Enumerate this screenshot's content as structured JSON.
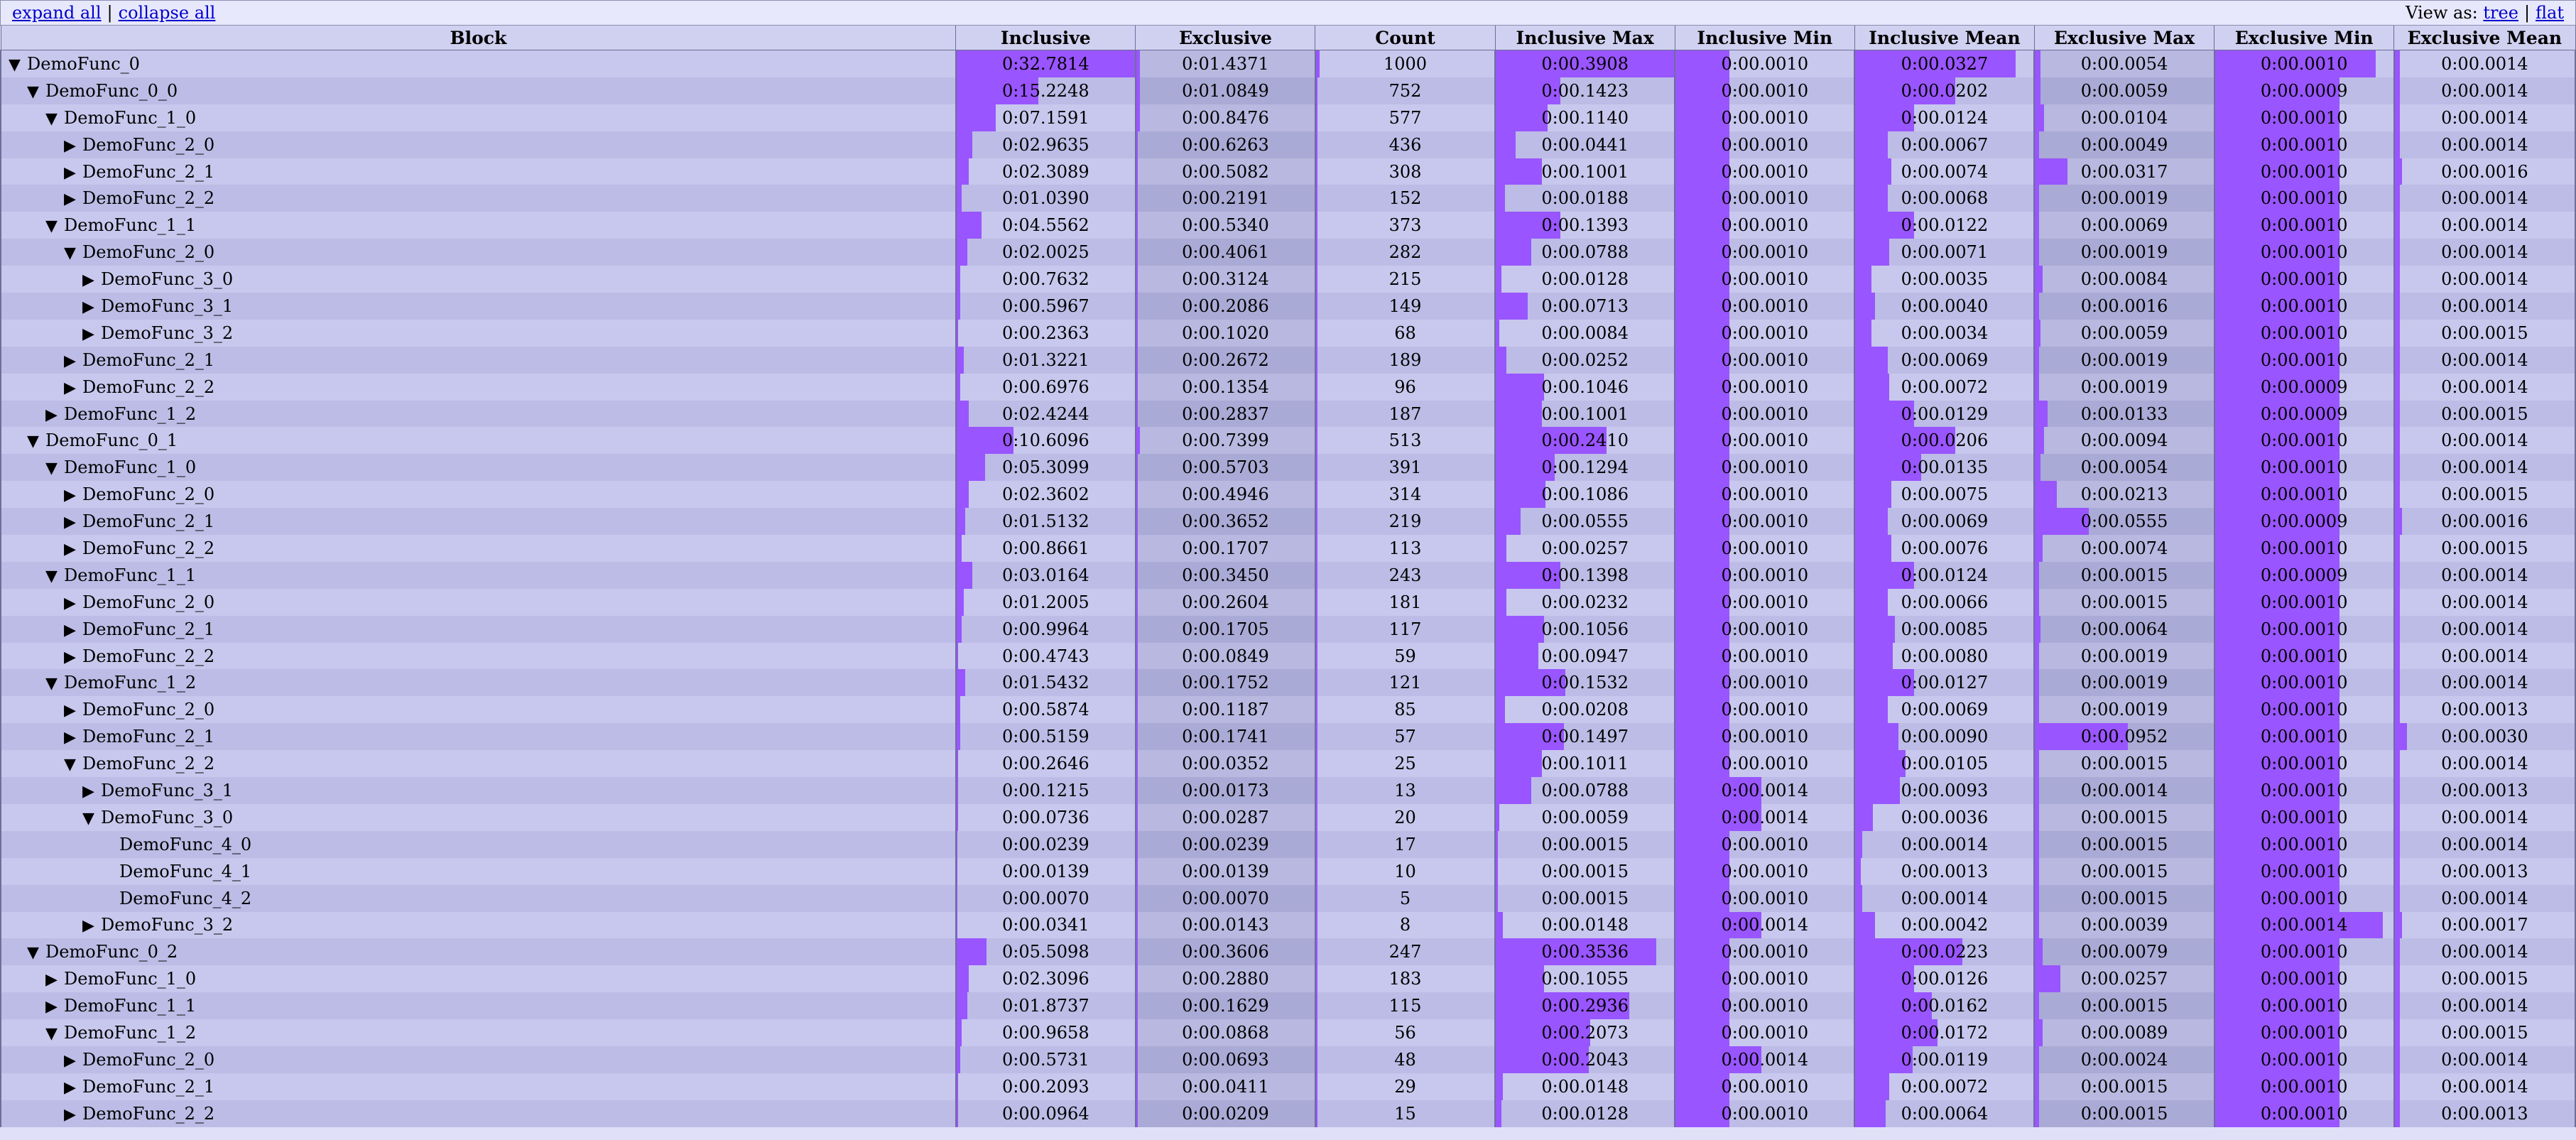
{
  "controls": {
    "expand_all": "expand all",
    "sep": "|",
    "collapse_all": "collapse all",
    "view_as": "View as:",
    "tree": "tree",
    "flat": "flat"
  },
  "columns": [
    "Block",
    "Inclusive",
    "Exclusive",
    "Count",
    "Inclusive Max",
    "Inclusive Min",
    "Inclusive Mean",
    "Exclusive Max",
    "Exclusive Min",
    "Exclusive Mean"
  ],
  "bar_color": "#9955ff",
  "rows": [
    {
      "name": "DemoFunc_0",
      "depth": 0,
      "toggle": "▼",
      "vals": [
        "0:32.7814",
        "0:01.4371",
        "1000",
        "0:00.3908",
        "0:00.0010",
        "0:00.0327",
        "0:00.0054",
        "0:00.0010",
        "0:00.0014"
      ],
      "bars": [
        1.0,
        0.02,
        0.02,
        1.0,
        0.3,
        0.9,
        0.03,
        0.9,
        0.03
      ]
    },
    {
      "name": "DemoFunc_0_0",
      "depth": 1,
      "toggle": "▼",
      "vals": [
        "0:15.2248",
        "0:01.0849",
        "752",
        "0:00.1423",
        "0:00.0010",
        "0:00.0202",
        "0:00.0059",
        "0:00.0009",
        "0:00.0014"
      ],
      "bars": [
        0.46,
        0.02,
        0.01,
        0.36,
        0.3,
        0.56,
        0.03,
        0.7,
        0.03
      ]
    },
    {
      "name": "DemoFunc_1_0",
      "depth": 2,
      "toggle": "▼",
      "vals": [
        "0:07.1591",
        "0:00.8476",
        "577",
        "0:00.1140",
        "0:00.0010",
        "0:00.0124",
        "0:00.0104",
        "0:00.0010",
        "0:00.0014"
      ],
      "bars": [
        0.22,
        0.02,
        0.01,
        0.29,
        0.3,
        0.33,
        0.05,
        0.7,
        0.03
      ]
    },
    {
      "name": "DemoFunc_2_0",
      "depth": 3,
      "toggle": "▶",
      "vals": [
        "0:02.9635",
        "0:00.6263",
        "436",
        "0:00.0441",
        "0:00.0010",
        "0:00.0067",
        "0:00.0049",
        "0:00.0010",
        "0:00.0014"
      ],
      "bars": [
        0.09,
        0.01,
        0.01,
        0.11,
        0.3,
        0.18,
        0.02,
        0.7,
        0.03
      ]
    },
    {
      "name": "DemoFunc_2_1",
      "depth": 3,
      "toggle": "▶",
      "vals": [
        "0:02.3089",
        "0:00.5082",
        "308",
        "0:00.1001",
        "0:00.0010",
        "0:00.0074",
        "0:00.0317",
        "0:00.0010",
        "0:00.0016"
      ],
      "bars": [
        0.07,
        0.01,
        0.01,
        0.26,
        0.3,
        0.2,
        0.18,
        0.7,
        0.04
      ]
    },
    {
      "name": "DemoFunc_2_2",
      "depth": 3,
      "toggle": "▶",
      "vals": [
        "0:01.0390",
        "0:00.2191",
        "152",
        "0:00.0188",
        "0:00.0010",
        "0:00.0068",
        "0:00.0019",
        "0:00.0010",
        "0:00.0014"
      ],
      "bars": [
        0.03,
        0.01,
        0.01,
        0.05,
        0.3,
        0.18,
        0.02,
        0.7,
        0.03
      ]
    },
    {
      "name": "DemoFunc_1_1",
      "depth": 2,
      "toggle": "▼",
      "vals": [
        "0:04.5562",
        "0:00.5340",
        "373",
        "0:00.1393",
        "0:00.0010",
        "0:00.0122",
        "0:00.0069",
        "0:00.0010",
        "0:00.0014"
      ],
      "bars": [
        0.14,
        0.01,
        0.01,
        0.36,
        0.3,
        0.33,
        0.02,
        0.7,
        0.03
      ]
    },
    {
      "name": "DemoFunc_2_0",
      "depth": 3,
      "toggle": "▼",
      "vals": [
        "0:02.0025",
        "0:00.4061",
        "282",
        "0:00.0788",
        "0:00.0010",
        "0:00.0071",
        "0:00.0019",
        "0:00.0010",
        "0:00.0014"
      ],
      "bars": [
        0.06,
        0.01,
        0.01,
        0.2,
        0.3,
        0.19,
        0.02,
        0.7,
        0.03
      ]
    },
    {
      "name": "DemoFunc_3_0",
      "depth": 4,
      "toggle": "▶",
      "vals": [
        "0:00.7632",
        "0:00.3124",
        "215",
        "0:00.0128",
        "0:00.0010",
        "0:00.0035",
        "0:00.0084",
        "0:00.0010",
        "0:00.0014"
      ],
      "bars": [
        0.02,
        0.01,
        0.01,
        0.03,
        0.3,
        0.09,
        0.04,
        0.7,
        0.03
      ]
    },
    {
      "name": "DemoFunc_3_1",
      "depth": 4,
      "toggle": "▶",
      "vals": [
        "0:00.5967",
        "0:00.2086",
        "149",
        "0:00.0713",
        "0:00.0010",
        "0:00.0040",
        "0:00.0016",
        "0:00.0010",
        "0:00.0014"
      ],
      "bars": [
        0.02,
        0.01,
        0.01,
        0.18,
        0.3,
        0.11,
        0.02,
        0.7,
        0.03
      ]
    },
    {
      "name": "DemoFunc_3_2",
      "depth": 4,
      "toggle": "▶",
      "vals": [
        "0:00.2363",
        "0:00.1020",
        "68",
        "0:00.0084",
        "0:00.0010",
        "0:00.0034",
        "0:00.0059",
        "0:00.0010",
        "0:00.0015"
      ],
      "bars": [
        0.01,
        0.01,
        0.01,
        0.02,
        0.3,
        0.09,
        0.03,
        0.7,
        0.03
      ]
    },
    {
      "name": "DemoFunc_2_1",
      "depth": 3,
      "toggle": "▶",
      "vals": [
        "0:01.3221",
        "0:00.2672",
        "189",
        "0:00.0252",
        "0:00.0010",
        "0:00.0069",
        "0:00.0019",
        "0:00.0010",
        "0:00.0014"
      ],
      "bars": [
        0.04,
        0.01,
        0.01,
        0.06,
        0.3,
        0.18,
        0.02,
        0.7,
        0.03
      ]
    },
    {
      "name": "DemoFunc_2_2",
      "depth": 3,
      "toggle": "▶",
      "vals": [
        "0:00.6976",
        "0:00.1354",
        "96",
        "0:00.1046",
        "0:00.0010",
        "0:00.0072",
        "0:00.0019",
        "0:00.0009",
        "0:00.0014"
      ],
      "bars": [
        0.02,
        0.01,
        0.01,
        0.27,
        0.3,
        0.19,
        0.02,
        0.7,
        0.03
      ]
    },
    {
      "name": "DemoFunc_1_2",
      "depth": 2,
      "toggle": "▶",
      "vals": [
        "0:02.4244",
        "0:00.2837",
        "187",
        "0:00.1001",
        "0:00.0010",
        "0:00.0129",
        "0:00.0133",
        "0:00.0009",
        "0:00.0015"
      ],
      "bars": [
        0.07,
        0.01,
        0.01,
        0.26,
        0.3,
        0.33,
        0.07,
        0.7,
        0.03
      ]
    },
    {
      "name": "DemoFunc_0_1",
      "depth": 1,
      "toggle": "▼",
      "vals": [
        "0:10.6096",
        "0:00.7399",
        "513",
        "0:00.2410",
        "0:00.0010",
        "0:00.0206",
        "0:00.0094",
        "0:00.0010",
        "0:00.0014"
      ],
      "bars": [
        0.32,
        0.02,
        0.01,
        0.62,
        0.3,
        0.56,
        0.05,
        0.7,
        0.03
      ]
    },
    {
      "name": "DemoFunc_1_0",
      "depth": 2,
      "toggle": "▼",
      "vals": [
        "0:05.3099",
        "0:00.5703",
        "391",
        "0:00.1294",
        "0:00.0010",
        "0:00.0135",
        "0:00.0054",
        "0:00.0010",
        "0:00.0014"
      ],
      "bars": [
        0.16,
        0.01,
        0.01,
        0.33,
        0.3,
        0.37,
        0.03,
        0.7,
        0.03
      ]
    },
    {
      "name": "DemoFunc_2_0",
      "depth": 3,
      "toggle": "▶",
      "vals": [
        "0:02.3602",
        "0:00.4946",
        "314",
        "0:00.1086",
        "0:00.0010",
        "0:00.0075",
        "0:00.0213",
        "0:00.0010",
        "0:00.0015"
      ],
      "bars": [
        0.07,
        0.01,
        0.01,
        0.28,
        0.3,
        0.2,
        0.12,
        0.7,
        0.03
      ]
    },
    {
      "name": "DemoFunc_2_1",
      "depth": 3,
      "toggle": "▶",
      "vals": [
        "0:01.5132",
        "0:00.3652",
        "219",
        "0:00.0555",
        "0:00.0010",
        "0:00.0069",
        "0:00.0555",
        "0:00.0009",
        "0:00.0016"
      ],
      "bars": [
        0.05,
        0.01,
        0.01,
        0.14,
        0.3,
        0.18,
        0.3,
        0.7,
        0.04
      ]
    },
    {
      "name": "DemoFunc_2_2",
      "depth": 3,
      "toggle": "▶",
      "vals": [
        "0:00.8661",
        "0:00.1707",
        "113",
        "0:00.0257",
        "0:00.0010",
        "0:00.0076",
        "0:00.0074",
        "0:00.0010",
        "0:00.0015"
      ],
      "bars": [
        0.03,
        0.01,
        0.01,
        0.06,
        0.3,
        0.2,
        0.04,
        0.7,
        0.03
      ]
    },
    {
      "name": "DemoFunc_1_1",
      "depth": 2,
      "toggle": "▼",
      "vals": [
        "0:03.0164",
        "0:00.3450",
        "243",
        "0:00.1398",
        "0:00.0010",
        "0:00.0124",
        "0:00.0015",
        "0:00.0009",
        "0:00.0014"
      ],
      "bars": [
        0.09,
        0.01,
        0.01,
        0.36,
        0.3,
        0.33,
        0.02,
        0.7,
        0.03
      ]
    },
    {
      "name": "DemoFunc_2_0",
      "depth": 3,
      "toggle": "▶",
      "vals": [
        "0:01.2005",
        "0:00.2604",
        "181",
        "0:00.0232",
        "0:00.0010",
        "0:00.0066",
        "0:00.0015",
        "0:00.0010",
        "0:00.0014"
      ],
      "bars": [
        0.04,
        0.01,
        0.01,
        0.06,
        0.3,
        0.18,
        0.02,
        0.7,
        0.03
      ]
    },
    {
      "name": "DemoFunc_2_1",
      "depth": 3,
      "toggle": "▶",
      "vals": [
        "0:00.9964",
        "0:00.1705",
        "117",
        "0:00.1056",
        "0:00.0010",
        "0:00.0085",
        "0:00.0064",
        "0:00.0010",
        "0:00.0014"
      ],
      "bars": [
        0.03,
        0.01,
        0.01,
        0.27,
        0.3,
        0.22,
        0.03,
        0.7,
        0.03
      ]
    },
    {
      "name": "DemoFunc_2_2",
      "depth": 3,
      "toggle": "▶",
      "vals": [
        "0:00.4743",
        "0:00.0849",
        "59",
        "0:00.0947",
        "0:00.0010",
        "0:00.0080",
        "0:00.0019",
        "0:00.0010",
        "0:00.0014"
      ],
      "bars": [
        0.01,
        0.01,
        0.01,
        0.24,
        0.3,
        0.21,
        0.02,
        0.7,
        0.03
      ]
    },
    {
      "name": "DemoFunc_1_2",
      "depth": 2,
      "toggle": "▼",
      "vals": [
        "0:01.5432",
        "0:00.1752",
        "121",
        "0:00.1532",
        "0:00.0010",
        "0:00.0127",
        "0:00.0019",
        "0:00.0010",
        "0:00.0014"
      ],
      "bars": [
        0.05,
        0.01,
        0.01,
        0.39,
        0.3,
        0.33,
        0.02,
        0.7,
        0.03
      ]
    },
    {
      "name": "DemoFunc_2_0",
      "depth": 3,
      "toggle": "▶",
      "vals": [
        "0:00.5874",
        "0:00.1187",
        "85",
        "0:00.0208",
        "0:00.0010",
        "0:00.0069",
        "0:00.0019",
        "0:00.0010",
        "0:00.0013"
      ],
      "bars": [
        0.02,
        0.01,
        0.01,
        0.05,
        0.3,
        0.18,
        0.02,
        0.7,
        0.03
      ]
    },
    {
      "name": "DemoFunc_2_1",
      "depth": 3,
      "toggle": "▶",
      "vals": [
        "0:00.5159",
        "0:00.1741",
        "57",
        "0:00.1497",
        "0:00.0010",
        "0:00.0090",
        "0:00.0952",
        "0:00.0010",
        "0:00.0030"
      ],
      "bars": [
        0.02,
        0.01,
        0.01,
        0.38,
        0.3,
        0.24,
        0.52,
        0.7,
        0.07
      ]
    },
    {
      "name": "DemoFunc_2_2",
      "depth": 3,
      "toggle": "▼",
      "vals": [
        "0:00.2646",
        "0:00.0352",
        "25",
        "0:00.1011",
        "0:00.0010",
        "0:00.0105",
        "0:00.0015",
        "0:00.0010",
        "0:00.0014"
      ],
      "bars": [
        0.01,
        0.01,
        0.01,
        0.26,
        0.3,
        0.28,
        0.02,
        0.7,
        0.03
      ]
    },
    {
      "name": "DemoFunc_3_1",
      "depth": 4,
      "toggle": "▶",
      "vals": [
        "0:00.1215",
        "0:00.0173",
        "13",
        "0:00.0788",
        "0:00.0014",
        "0:00.0093",
        "0:00.0014",
        "0:00.0010",
        "0:00.0013"
      ],
      "bars": [
        0.01,
        0.01,
        0.01,
        0.2,
        0.48,
        0.25,
        0.02,
        0.7,
        0.03
      ]
    },
    {
      "name": "DemoFunc_3_0",
      "depth": 4,
      "toggle": "▼",
      "vals": [
        "0:00.0736",
        "0:00.0287",
        "20",
        "0:00.0059",
        "0:00.0014",
        "0:00.0036",
        "0:00.0015",
        "0:00.0010",
        "0:00.0014"
      ],
      "bars": [
        0.01,
        0.01,
        0.01,
        0.02,
        0.48,
        0.1,
        0.02,
        0.7,
        0.03
      ]
    },
    {
      "name": "DemoFunc_4_0",
      "depth": 5,
      "toggle": "",
      "vals": [
        "0:00.0239",
        "0:00.0239",
        "17",
        "0:00.0015",
        "0:00.0010",
        "0:00.0014",
        "0:00.0015",
        "0:00.0010",
        "0:00.0014"
      ],
      "bars": [
        0.005,
        0.01,
        0.01,
        0.01,
        0.3,
        0.04,
        0.02,
        0.7,
        0.03
      ]
    },
    {
      "name": "DemoFunc_4_1",
      "depth": 5,
      "toggle": "",
      "vals": [
        "0:00.0139",
        "0:00.0139",
        "10",
        "0:00.0015",
        "0:00.0010",
        "0:00.0013",
        "0:00.0015",
        "0:00.0010",
        "0:00.0013"
      ],
      "bars": [
        0.005,
        0.01,
        0.01,
        0.01,
        0.3,
        0.03,
        0.02,
        0.7,
        0.03
      ]
    },
    {
      "name": "DemoFunc_4_2",
      "depth": 5,
      "toggle": "",
      "vals": [
        "0:00.0070",
        "0:00.0070",
        "5",
        "0:00.0015",
        "0:00.0010",
        "0:00.0014",
        "0:00.0015",
        "0:00.0010",
        "0:00.0014"
      ],
      "bars": [
        0.005,
        0.01,
        0.01,
        0.01,
        0.3,
        0.04,
        0.02,
        0.7,
        0.03
      ]
    },
    {
      "name": "DemoFunc_3_2",
      "depth": 4,
      "toggle": "▶",
      "vals": [
        "0:00.0341",
        "0:00.0143",
        "8",
        "0:00.0148",
        "0:00.0014",
        "0:00.0042",
        "0:00.0039",
        "0:00.0014",
        "0:00.0017"
      ],
      "bars": [
        0.005,
        0.01,
        0.01,
        0.04,
        0.48,
        0.11,
        0.02,
        0.94,
        0.04
      ]
    },
    {
      "name": "DemoFunc_0_2",
      "depth": 1,
      "toggle": "▼",
      "vals": [
        "0:05.5098",
        "0:00.3606",
        "247",
        "0:00.3536",
        "0:00.0010",
        "0:00.0223",
        "0:00.0079",
        "0:00.0010",
        "0:00.0014"
      ],
      "bars": [
        0.17,
        0.01,
        0.01,
        0.9,
        0.3,
        0.6,
        0.04,
        0.7,
        0.03
      ]
    },
    {
      "name": "DemoFunc_1_0",
      "depth": 2,
      "toggle": "▶",
      "vals": [
        "0:02.3096",
        "0:00.2880",
        "183",
        "0:00.1055",
        "0:00.0010",
        "0:00.0126",
        "0:00.0257",
        "0:00.0010",
        "0:00.0015"
      ],
      "bars": [
        0.07,
        0.01,
        0.01,
        0.27,
        0.3,
        0.33,
        0.14,
        0.7,
        0.03
      ]
    },
    {
      "name": "DemoFunc_1_1",
      "depth": 2,
      "toggle": "▶",
      "vals": [
        "0:01.8737",
        "0:00.1629",
        "115",
        "0:00.2936",
        "0:00.0010",
        "0:00.0162",
        "0:00.0015",
        "0:00.0010",
        "0:00.0014"
      ],
      "bars": [
        0.06,
        0.01,
        0.01,
        0.75,
        0.3,
        0.43,
        0.02,
        0.7,
        0.03
      ]
    },
    {
      "name": "DemoFunc_1_2",
      "depth": 2,
      "toggle": "▼",
      "vals": [
        "0:00.9658",
        "0:00.0868",
        "56",
        "0:00.2073",
        "0:00.0010",
        "0:00.0172",
        "0:00.0089",
        "0:00.0010",
        "0:00.0015"
      ],
      "bars": [
        0.03,
        0.01,
        0.01,
        0.53,
        0.3,
        0.46,
        0.04,
        0.7,
        0.03
      ]
    },
    {
      "name": "DemoFunc_2_0",
      "depth": 3,
      "toggle": "▶",
      "vals": [
        "0:00.5731",
        "0:00.0693",
        "48",
        "0:00.2043",
        "0:00.0014",
        "0:00.0119",
        "0:00.0024",
        "0:00.0010",
        "0:00.0014"
      ],
      "bars": [
        0.02,
        0.01,
        0.01,
        0.52,
        0.48,
        0.32,
        0.02,
        0.7,
        0.03
      ]
    },
    {
      "name": "DemoFunc_2_1",
      "depth": 3,
      "toggle": "▶",
      "vals": [
        "0:00.2093",
        "0:00.0411",
        "29",
        "0:00.0148",
        "0:00.0010",
        "0:00.0072",
        "0:00.0015",
        "0:00.0010",
        "0:00.0014"
      ],
      "bars": [
        0.01,
        0.01,
        0.01,
        0.04,
        0.3,
        0.19,
        0.02,
        0.7,
        0.03
      ]
    },
    {
      "name": "DemoFunc_2_2",
      "depth": 3,
      "toggle": "▶",
      "vals": [
        "0:00.0964",
        "0:00.0209",
        "15",
        "0:00.0128",
        "0:00.0010",
        "0:00.0064",
        "0:00.0015",
        "0:00.0010",
        "0:00.0013"
      ],
      "bars": [
        0.01,
        0.01,
        0.01,
        0.03,
        0.3,
        0.17,
        0.02,
        0.7,
        0.03
      ]
    }
  ]
}
